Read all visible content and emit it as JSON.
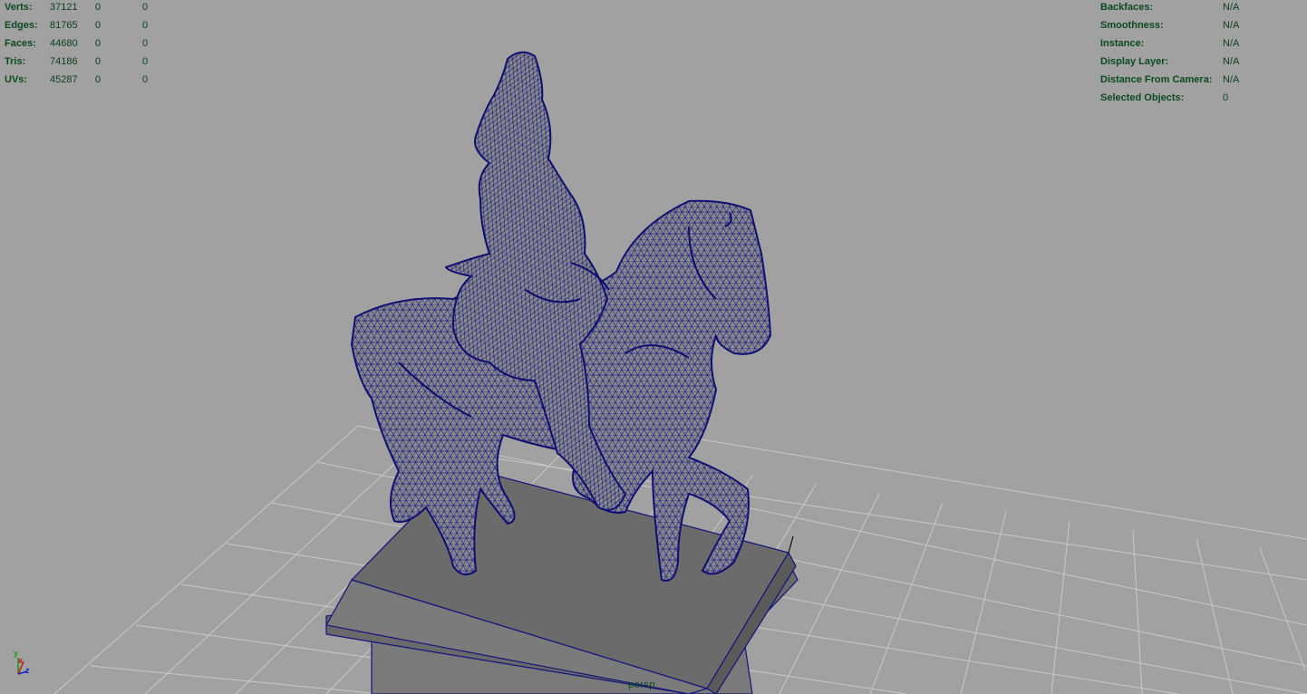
{
  "heads_up_stats": {
    "rows": [
      {
        "label": "Verts:",
        "values": [
          "37121",
          "0",
          "0"
        ]
      },
      {
        "label": "Edges:",
        "values": [
          "81765",
          "0",
          "0"
        ]
      },
      {
        "label": "Faces:",
        "values": [
          "44680",
          "0",
          "0"
        ]
      },
      {
        "label": "Tris:",
        "values": [
          "74186",
          "0",
          "0"
        ]
      },
      {
        "label": "UVs:",
        "values": [
          "45287",
          "0",
          "0"
        ]
      }
    ]
  },
  "heads_up_info": {
    "rows": [
      {
        "label": "Backfaces:",
        "value": "N/A"
      },
      {
        "label": "Smoothness:",
        "value": "N/A"
      },
      {
        "label": "Instance:",
        "value": "N/A"
      },
      {
        "label": "Display Layer:",
        "value": "N/A"
      },
      {
        "label": "Distance From Camera:",
        "value": "N/A"
      },
      {
        "label": "Selected Objects:",
        "value": "0"
      }
    ]
  },
  "camera": {
    "name": "persp"
  },
  "axis_gizmo": {
    "y": "y",
    "x": "x",
    "z": "z"
  },
  "colors": {
    "background": "#a1a1a1",
    "grid": "#c8c8c8",
    "wireframe": "#13137a",
    "hud_text": "#0b4a1f",
    "pedestal": "#6e6e6e",
    "axis_x": "#d01010",
    "axis_y": "#10a010",
    "axis_z": "#1020c0"
  }
}
